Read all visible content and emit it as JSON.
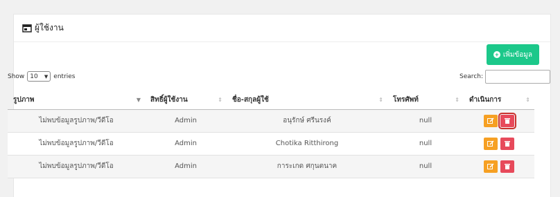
{
  "card": {
    "title": "ผู้ใช้งาน",
    "title_icon": "window-icon"
  },
  "toolbar": {
    "add_label": "เพิ่มข้อมูล",
    "add_icon": "plus-circle-icon"
  },
  "length": {
    "show": "Show",
    "value": "10",
    "entries": "entries"
  },
  "search": {
    "label": "Search:",
    "value": ""
  },
  "table": {
    "headers": [
      "รูปภาพ",
      "สิทธิ์ผู้ใช้งาน",
      "ชื่อ-สกุลผู้ใช้",
      "โทรศัพท์",
      "ดำเนินการ"
    ],
    "rows": [
      {
        "image": "ไม่พบข้อมูลรูปภาพ/วีดีโอ",
        "role": "Admin",
        "name": "อนุรักษ์ ศรีนรงค์",
        "phone": "null"
      },
      {
        "image": "ไม่พบข้อมูลรูปภาพ/วีดีโอ",
        "role": "Admin",
        "name": "Chotika Ritthirong",
        "phone": "null"
      },
      {
        "image": "ไม่พบข้อมูลรูปภาพ/วีดีโอ",
        "role": "Admin",
        "name": "การะเกด ศกุนตนาค",
        "phone": "null"
      }
    ]
  },
  "colors": {
    "add": "#1cc88a",
    "edit": "#f6a023",
    "delete": "#e74a5b"
  }
}
